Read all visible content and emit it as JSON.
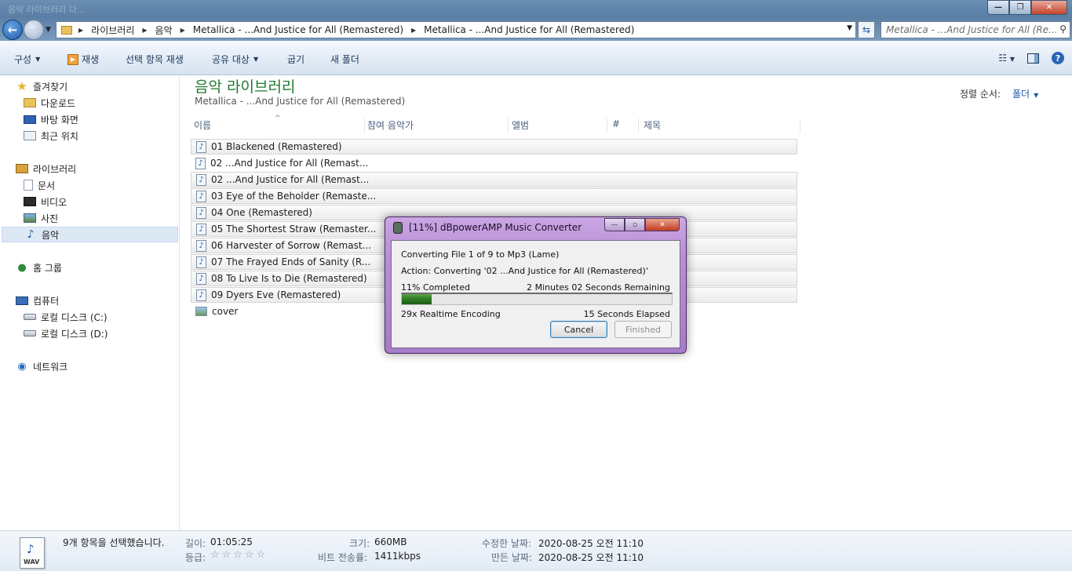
{
  "window": {
    "faint_title": "음악 라이브러리 다...",
    "minimize": "—",
    "restore": "❐",
    "close": "✕"
  },
  "address": {
    "crumbs": [
      "라이브러리",
      "음악",
      "Metallica - ...And Justice for All (Remastered)",
      "Metallica - ...And Justice for All (Remastered)"
    ],
    "search_placeholder": "Metallica - ...And Justice for All (Re..."
  },
  "toolbar": {
    "organize": "구성",
    "play": "재생",
    "play_selected": "선택 항목 재생",
    "share": "공유 대상",
    "burn": "굽기",
    "new_folder": "새 폴더"
  },
  "sidebar": {
    "favorites": "즐겨찾기",
    "downloads": "다운로드",
    "desktop": "바탕 화면",
    "recent": "최근 위치",
    "libraries": "라이브러리",
    "documents": "문서",
    "videos": "비디오",
    "pictures": "사진",
    "music": "음악",
    "homegroup": "홈 그룹",
    "computer": "컴퓨터",
    "disk_c": "로컬 디스크 (C:)",
    "disk_d": "로컬 디스크 (D:)",
    "network": "네트워크"
  },
  "content": {
    "title": "음악 라이브러리",
    "subtitle": "Metallica - ...And Justice for All (Remastered)",
    "sort_label": "정렬 순서:",
    "sort_value": "폴더"
  },
  "columns": {
    "name": "이름",
    "artist": "참여 음악가",
    "album": "앨범",
    "track": "#",
    "title": "제목"
  },
  "files": [
    "01 Blackened (Remastered)",
    "02 ...And Justice for All (Remast...",
    "02 ...And Justice for All (Remast...",
    "03 Eye of the Beholder (Remaste...",
    "04 One (Remastered)",
    "05 The Shortest Straw (Remaster...",
    "06 Harvester of Sorrow (Remast...",
    "07 The Frayed Ends of Sanity (R...",
    "08 To Live Is to Die (Remastered)",
    "09 Dyers Eve (Remastered)",
    "cover"
  ],
  "dialog": {
    "title": "[11%] dBpowerAMP Music Converter",
    "converting": "Converting File 1 of 9 to Mp3 (Lame)",
    "action": "Action: Converting '02 ...And Justice for All (Remastered)'",
    "completed": "11% Completed",
    "remaining": "2 Minutes 02 Seconds Remaining",
    "progress": 0.11,
    "speed": "29x Realtime Encoding",
    "elapsed": "15 Seconds Elapsed",
    "cancel": "Cancel",
    "finished": "Finished"
  },
  "details": {
    "selected": "9개 항목을 선택했습니다.",
    "icon_label": "WAV",
    "length_label": "길이:",
    "length_value": "01:05:25",
    "rating_label": "등급:",
    "size_label": "크기:",
    "size_value": "660MB",
    "bitrate_label": "비트 전송률:",
    "bitrate_value": "1411kbps",
    "modified_label": "수정한 날짜:",
    "modified_value": "2020-08-25 오전 11:10",
    "created_label": "만든 날짜:",
    "created_value": "2020-08-25 오전 11:10"
  }
}
